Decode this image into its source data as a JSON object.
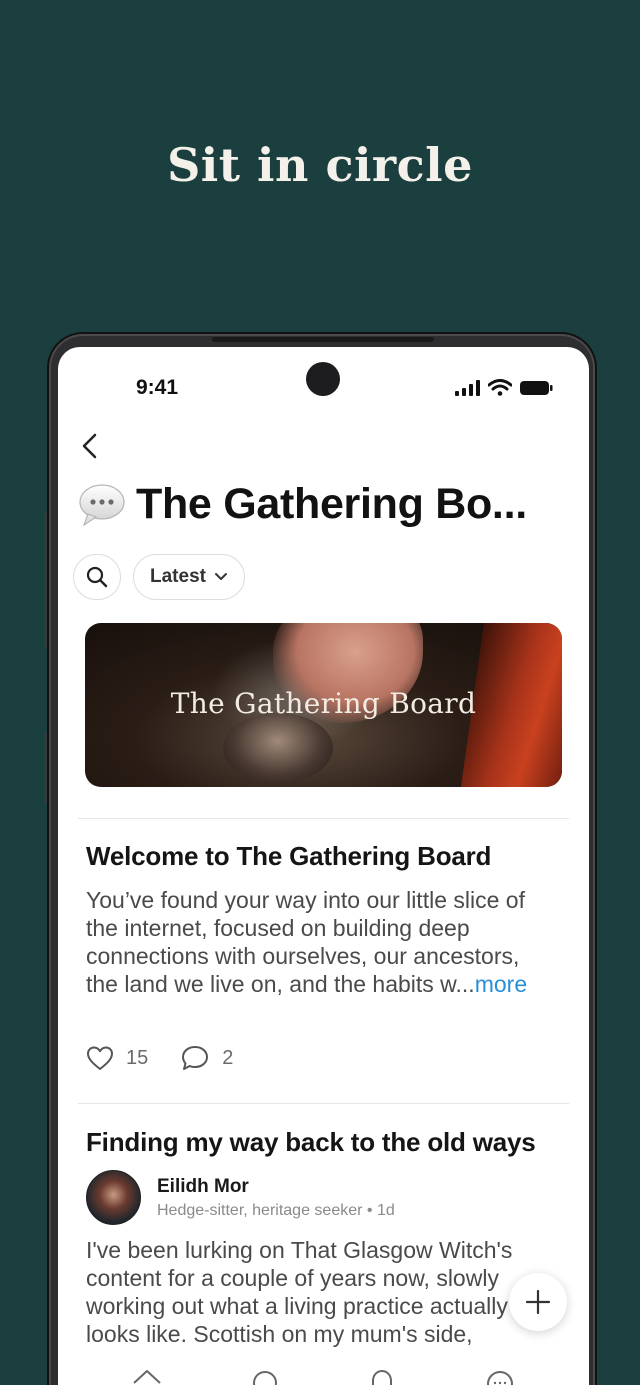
{
  "promo": {
    "headline": "Sit in circle"
  },
  "status_bar": {
    "time": "9:41"
  },
  "nav": {
    "back_icon": "chevron-left-icon"
  },
  "board": {
    "emoji_icon": "speech-bubble-icon",
    "title": "The Gathering Bo..."
  },
  "filters": {
    "search_icon": "search-icon",
    "sort_label": "Latest"
  },
  "banner": {
    "title": "The Gathering Board"
  },
  "posts": [
    {
      "title": "Welcome to The Gathering Board",
      "body": "You’ve found your way into our little slice of the internet, focused on building deep connections with ourselves, our ancestors, the land we live on, and the habits w...",
      "more_label": "more",
      "likes": "15",
      "comments": "2"
    },
    {
      "title": "Finding my way back to the old ways",
      "author_name": "Eilidh Mor",
      "author_meta": "Hedge-sitter, heritage seeker • 1d",
      "body": "I've been lurking on That Glasgow Witch's content for a couple of years now, slowly working out what a living practice actually looks like. Scottish on my mum's side,"
    }
  ],
  "fab": {
    "icon": "plus-icon"
  },
  "colors": {
    "background": "#1b3f3e",
    "link": "#2a8fd6"
  }
}
